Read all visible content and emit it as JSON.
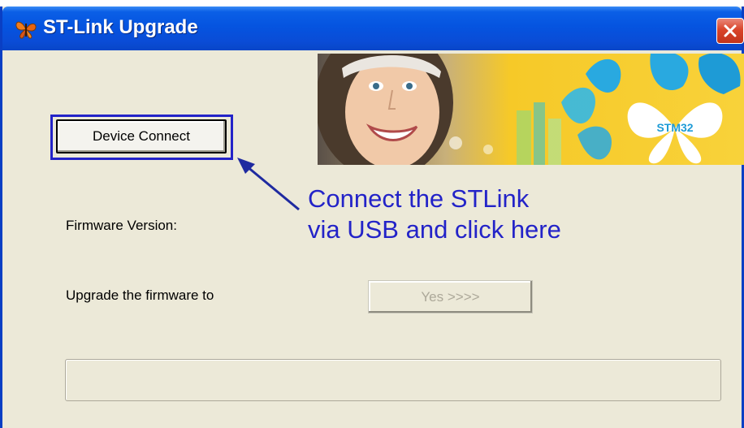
{
  "window": {
    "title": "ST-Link Upgrade",
    "icon": "butterfly-icon",
    "close_icon": "close-icon"
  },
  "banner": {
    "logo_text": "STM32",
    "brand_color": "#29a9e0",
    "background_color": "#f6c928"
  },
  "device_connect": {
    "label": "Device Connect"
  },
  "annotation": {
    "line1": "Connect the STLink",
    "line2": "via USB and click here",
    "color": "#2323c8"
  },
  "firmware": {
    "version_label": "Firmware Version:",
    "upgrade_label": "Upgrade the firmware to",
    "yes_button_label": "Yes >>>>"
  },
  "progress": {
    "value": 0
  }
}
